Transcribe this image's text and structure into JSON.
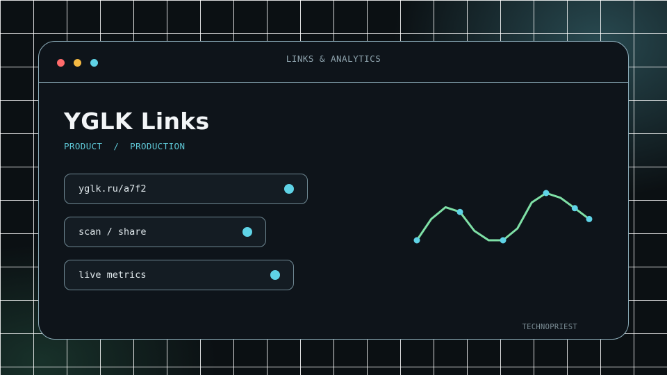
{
  "window": {
    "title": "LINKS & ANALYTICS"
  },
  "header": {
    "title": "YGLK Links",
    "breadcrumb": [
      "PRODUCT",
      "PRODUCTION"
    ],
    "breadcrumb_separator": "/"
  },
  "items": [
    {
      "label": "yglk.ru/a7f2"
    },
    {
      "label": "scan / share"
    },
    {
      "label": "live metrics"
    }
  ],
  "footer": {
    "brand": "TECHNOPRIEST"
  },
  "sparkline": {
    "values": [
      0.0,
      0.45,
      0.7,
      0.6,
      0.2,
      0.0,
      0.0,
      0.25,
      0.8,
      1.0,
      0.9,
      0.68,
      0.45
    ],
    "marked_points": [
      0,
      3,
      6,
      9,
      11,
      12
    ],
    "line_color": "#7fe0a6",
    "marker_color": "#5fd3e6"
  },
  "colors": {
    "accent": "#5fd3e6",
    "breadcrumb": "#5fc9d8",
    "window_border": "#8fb0bd",
    "dot_red": "#ff6b6b",
    "dot_yellow": "#f4b942",
    "dot_cyan": "#5fd3e6"
  }
}
